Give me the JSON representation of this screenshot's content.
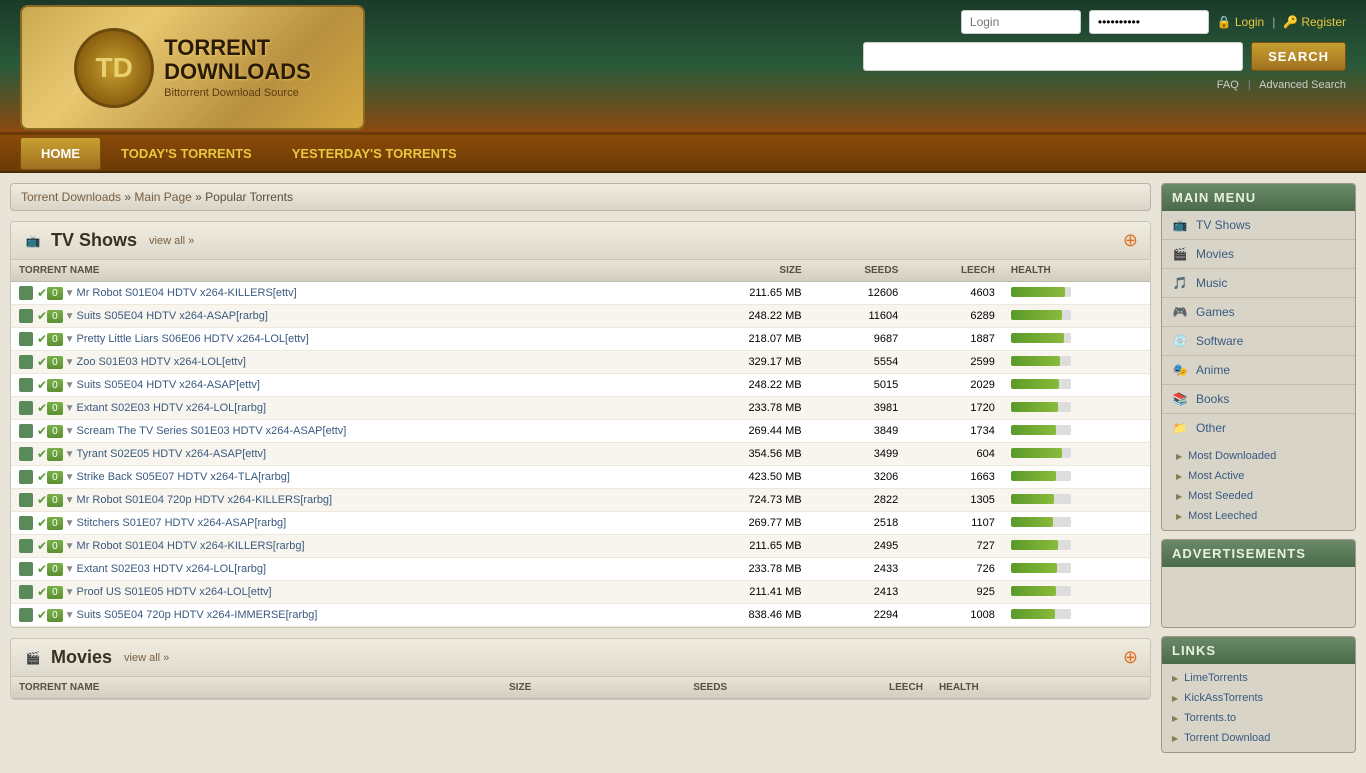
{
  "header": {
    "logo_title_line1": "TORRENT",
    "logo_title_line2": "DOWNLOADS",
    "logo_subtitle": "Bittorrent Download Source",
    "logo_badge": "TD",
    "login_placeholder": "Login",
    "password_placeholder": "••••••••••",
    "login_label": "Login",
    "register_label": "Register",
    "search_placeholder": "",
    "search_btn": "SEARCH",
    "faq_label": "FAQ",
    "advanced_search_label": "Advanced Search"
  },
  "navbar": {
    "items": [
      {
        "label": "HOME",
        "active": true
      },
      {
        "label": "TODAY'S TORRENTS",
        "active": false
      },
      {
        "label": "YESTERDAY'S TORRENTS",
        "active": false
      }
    ]
  },
  "breadcrumb": {
    "parts": [
      "Torrent Downloads",
      "Main Page",
      "Popular Torrents"
    ],
    "separators": [
      "»",
      "»"
    ]
  },
  "tv_shows": {
    "section_title": "TV Shows",
    "view_all": "view all »",
    "col_name": "TORRENT NAME",
    "col_size": "SIZE",
    "col_seeds": "SEEDS",
    "col_leech": "LEECH",
    "col_health": "HEALTH",
    "rows": [
      {
        "name": "Mr Robot S01E04 HDTV x264-KILLERS[ettv]",
        "size": "211.65 MB",
        "seeds": "12606",
        "leech": "4603",
        "health": 90
      },
      {
        "name": "Suits S05E04 HDTV x264-ASAP[rarbg]",
        "size": "248.22 MB",
        "seeds": "11604",
        "leech": "6289",
        "health": 85
      },
      {
        "name": "Pretty Little Liars S06E06 HDTV x264-LOL[ettv]",
        "size": "218.07 MB",
        "seeds": "9687",
        "leech": "1887",
        "health": 88
      },
      {
        "name": "Zoo S01E03 HDTV x264-LOL[ettv]",
        "size": "329.17 MB",
        "seeds": "5554",
        "leech": "2599",
        "health": 82
      },
      {
        "name": "Suits S05E04 HDTV x264-ASAP[ettv]",
        "size": "248.22 MB",
        "seeds": "5015",
        "leech": "2029",
        "health": 80
      },
      {
        "name": "Extant S02E03 HDTV x264-LOL[rarbg]",
        "size": "233.78 MB",
        "seeds": "3981",
        "leech": "1720",
        "health": 78
      },
      {
        "name": "Scream The TV Series S01E03 HDTV x264-ASAP[ettv]",
        "size": "269.44 MB",
        "seeds": "3849",
        "leech": "1734",
        "health": 76
      },
      {
        "name": "Tyrant S02E05 HDTV x264-ASAP[ettv]",
        "size": "354.56 MB",
        "seeds": "3499",
        "leech": "604",
        "health": 85
      },
      {
        "name": "Strike Back S05E07 HDTV x264-TLA[rarbg]",
        "size": "423.50 MB",
        "seeds": "3206",
        "leech": "1663",
        "health": 75
      },
      {
        "name": "Mr Robot S01E04 720p HDTV x264-KILLERS[rarbg]",
        "size": "724.73 MB",
        "seeds": "2822",
        "leech": "1305",
        "health": 72
      },
      {
        "name": "Stitchers S01E07 HDTV x264-ASAP[rarbg]",
        "size": "269.77 MB",
        "seeds": "2518",
        "leech": "1107",
        "health": 70
      },
      {
        "name": "Mr Robot S01E04 HDTV x264-KILLERS[rarbg]",
        "size": "211.65 MB",
        "seeds": "2495",
        "leech": "727",
        "health": 78
      },
      {
        "name": "Extant S02E03 HDTV x264-LOL[rarbg]",
        "size": "233.78 MB",
        "seeds": "2433",
        "leech": "726",
        "health": 77
      },
      {
        "name": "Proof US S01E05 HDTV x264-LOL[ettv]",
        "size": "211.41 MB",
        "seeds": "2413",
        "leech": "925",
        "health": 75
      },
      {
        "name": "Suits S05E04 720p HDTV x264-IMMERSE[rarbg]",
        "size": "838.46 MB",
        "seeds": "2294",
        "leech": "1008",
        "health": 73
      }
    ]
  },
  "movies": {
    "section_title": "Movies",
    "view_all": "view all »",
    "col_name": "TORRENT NAME",
    "col_size": "SIZE",
    "col_seeds": "SEEDS",
    "col_leech": "LEECH",
    "col_health": "HEALTH"
  },
  "sidebar": {
    "main_menu_header": "MAIN MENU",
    "menu_items": [
      {
        "label": "TV Shows",
        "icon": "📺"
      },
      {
        "label": "Movies",
        "icon": "🎬"
      },
      {
        "label": "Music",
        "icon": "🎵"
      },
      {
        "label": "Games",
        "icon": "🎮"
      },
      {
        "label": "Software",
        "icon": "💿"
      },
      {
        "label": "Anime",
        "icon": "🎭"
      },
      {
        "label": "Books",
        "icon": "📚"
      },
      {
        "label": "Other",
        "icon": "📁"
      }
    ],
    "sub_items": [
      {
        "label": "Most Downloaded"
      },
      {
        "label": "Most Active"
      },
      {
        "label": "Most Seeded"
      },
      {
        "label": "Most Leeched"
      }
    ],
    "ads_header": "ADVERTISEMENTS",
    "links_header": "LINKS",
    "links": [
      {
        "label": "LimeTorrents"
      },
      {
        "label": "KickAssTorrents"
      },
      {
        "label": "Torrents.to"
      },
      {
        "label": "Torrent Download"
      }
    ]
  }
}
